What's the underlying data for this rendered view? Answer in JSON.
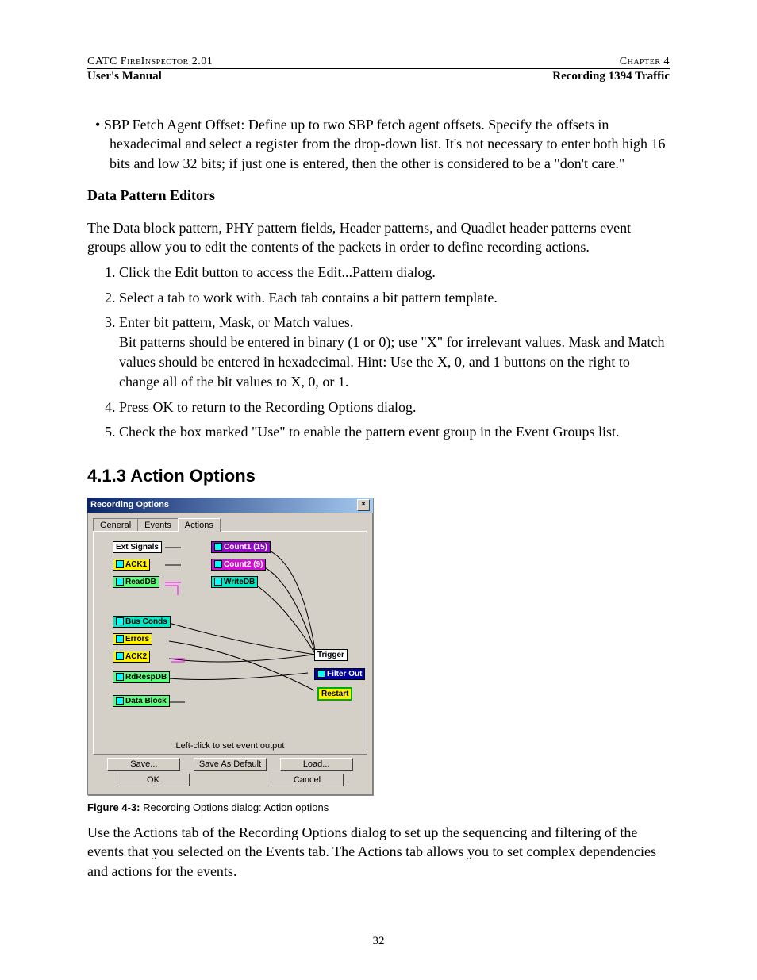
{
  "header": {
    "left": "CATC FireInspector 2.01",
    "right": "Chapter 4",
    "sub_left": "User's Manual",
    "sub_right": "Recording 1394 Traffic"
  },
  "bullet": {
    "text": "SBP Fetch Agent Offset: Define up to two SBP fetch agent offsets. Specify the offsets in hexadecimal and select a register from the drop-down list. It's not necessary to enter both high 16 bits and low 32 bits; if just one is entered, then the other is considered to be a \"don't care.\""
  },
  "dp_heading": "Data Pattern Editors",
  "dp_para": "The Data block pattern, PHY pattern fields, Header patterns, and Quadlet header patterns event groups allow you to edit the contents of the packets in order to define recording actions.",
  "steps": {
    "s1": "Click the Edit button to access the Edit...Pattern dialog.",
    "s2": "Select a tab to work with. Each tab contains a bit pattern template.",
    "s3a": "Enter bit pattern, Mask, or Match values.",
    "s3b": "Bit patterns should be entered in binary (1 or 0); use \"X\" for irrelevant values. Mask and Match values should be entered in hexadecimal. Hint: Use the X, 0, and 1 buttons on the right to change all of the bit values to X, 0, or 1.",
    "s4": "Press OK to return to the Recording Options dialog.",
    "s5": "Check the box marked \"Use\" to enable the pattern event group in the Event Groups list."
  },
  "section_heading": "4.1.3 Action Options",
  "fig_caption_bold": "Figure 4-3:",
  "fig_caption_rest": "  Recording Options dialog: Action options",
  "closing_para": "Use the Actions tab of the Recording Options dialog to set up the sequencing and filtering of the events that you selected on the Events tab. The Actions tab allows you to set complex dependencies and actions for the events.",
  "page_number": "32",
  "dialog": {
    "title": "Recording Options",
    "tabs": {
      "general": "General",
      "events": "Events",
      "actions": "Actions"
    },
    "events": {
      "ext_signals": "Ext Signals",
      "ack1": "ACK1",
      "readdb": "ReadDB",
      "bus_conds": "Bus Conds",
      "errors": "Errors",
      "ack2": "ACK2",
      "rdrespdb": "RdRespDB",
      "data_block": "Data Block"
    },
    "counters": {
      "count1": "Count1 (15)",
      "count2": "Count2 (9)",
      "writedb": "WriteDB"
    },
    "actions": {
      "trigger": "Trigger",
      "filter_out": "Filter Out",
      "restart": "Restart"
    },
    "hint": "Left-click to set event output",
    "buttons": {
      "save": "Save...",
      "save_default": "Save As Default",
      "load": "Load...",
      "ok": "OK",
      "cancel": "Cancel"
    }
  }
}
